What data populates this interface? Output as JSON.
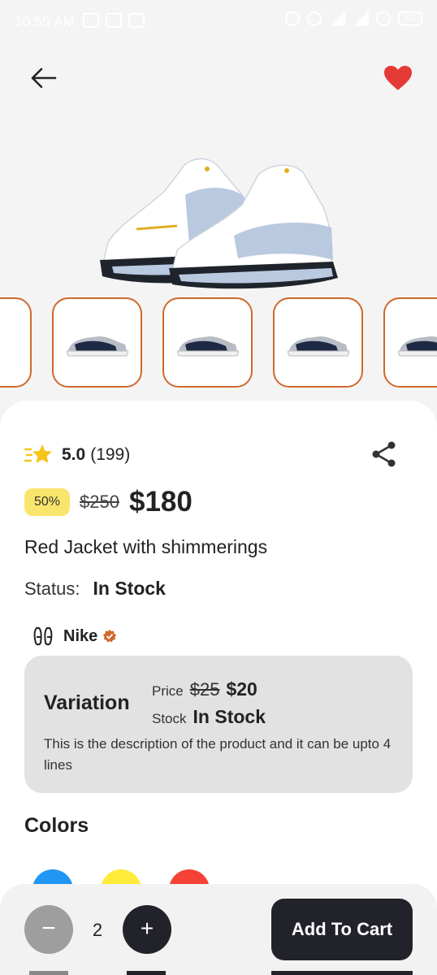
{
  "status_bar": {
    "time": "10:55 AM",
    "battery": "52"
  },
  "product": {
    "rating": "5.0",
    "rating_count": "(199)",
    "discount": "50%",
    "old_price": "$250",
    "price": "$180",
    "title": "Red Jacket with shimmerings",
    "status_label": "Status:",
    "status_value": "In Stock",
    "brand": "Nike"
  },
  "variation": {
    "title": "Variation",
    "price_label": "Price",
    "old_price": "$25",
    "price": "$20",
    "stock_label": "Stock",
    "stock_value": "In Stock",
    "description": "This is the description of the product and it can be upto 4 lines"
  },
  "colors": {
    "title": "Colors",
    "swatches": [
      "#2196f3",
      "#ffeb3b",
      "#f44336"
    ]
  },
  "cart": {
    "minus": "−",
    "quantity": "2",
    "plus": "+",
    "add_label": "Add To Cart"
  },
  "theme": {
    "accent": "#d0692b",
    "favorite": "#e53935",
    "badge": "#f9e56b",
    "dark": "#22222a"
  }
}
